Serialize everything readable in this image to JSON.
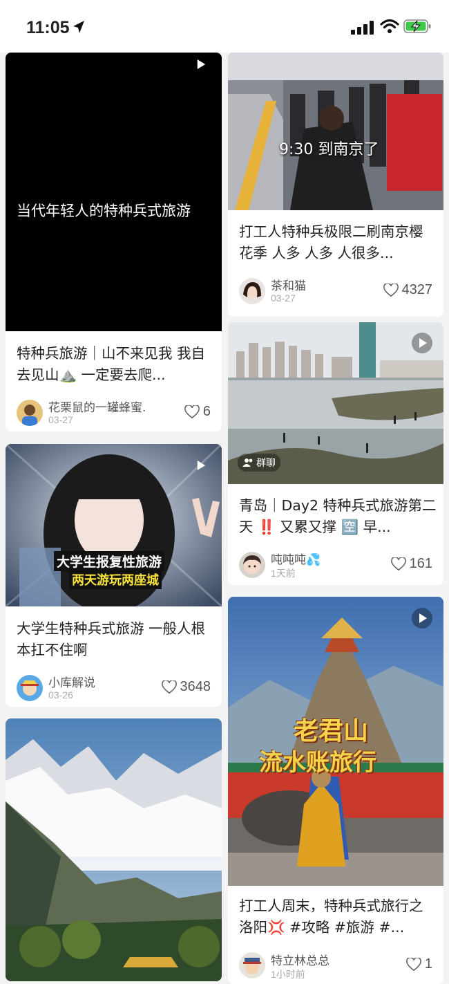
{
  "status_bar": {
    "time": "11:05"
  },
  "colors": {
    "background": "#f3f3f3",
    "card": "#ffffff",
    "text": "#222222",
    "muted": "#aaaaaa"
  },
  "feed": {
    "left": [
      {
        "cover_text": "当代年轻人的特种兵式旅游",
        "title": "特种兵旅游｜山不来见我 我自去见山⛰️ 一定要去爬...",
        "user": "花栗鼠的一罐蜂蜜.",
        "date": "03-27",
        "likes": "6",
        "is_video": true
      },
      {
        "cover_line1": "大学生报复性旅游",
        "cover_line2": "两天游玩两座城",
        "title": "大学生特种兵式旅游 一般人根本扛不住啊",
        "user": "小库解说",
        "date": "03-26",
        "likes": "3648",
        "is_video": true
      },
      {
        "title": "",
        "is_video": false
      }
    ],
    "right": [
      {
        "cover_text": "9:30 到南京了",
        "title": "打工人特种兵极限二刷南京樱花季 人多 人多 人很多...",
        "user": "茶和猫",
        "date": "03-27",
        "likes": "4327",
        "is_video": false
      },
      {
        "badge": "群聊",
        "title": "青岛｜Day2 特种兵式旅游第二天 ‼️ 又累又撑 🈳 早...",
        "user": "吨吨吨💦",
        "date": "1天前",
        "likes": "161",
        "is_video": true
      },
      {
        "cover_line1": "老君山",
        "cover_line2": "流水账旅行",
        "title": "打工人周末，特种兵式旅行之洛阳💢 #攻略 #旅游 #...",
        "user": "特立林总总",
        "date": "1小时前",
        "likes": "1",
        "is_video": true
      }
    ]
  }
}
